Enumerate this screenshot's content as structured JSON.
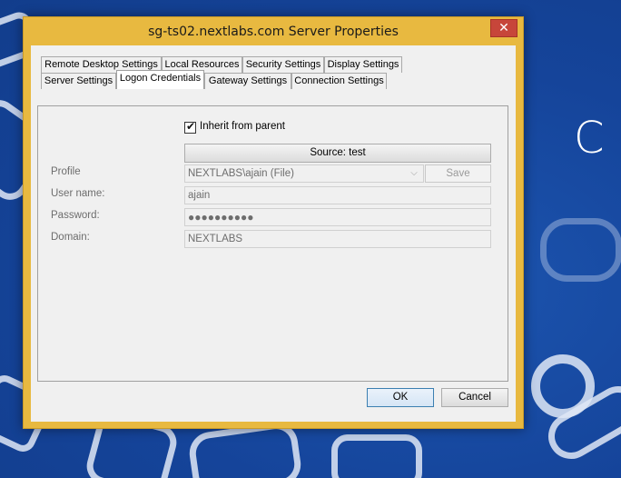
{
  "desktop": {
    "wallpaper_letter": "C"
  },
  "window": {
    "title": "sg-ts02.nextlabs.com Server Properties",
    "close_glyph": "✕"
  },
  "tabs_row1": [
    {
      "label": "Remote Desktop Settings"
    },
    {
      "label": "Local Resources"
    },
    {
      "label": "Security Settings"
    },
    {
      "label": "Display Settings"
    }
  ],
  "tabs_row2": [
    {
      "label": "Server Settings"
    },
    {
      "label": "Logon Credentials",
      "active": true
    },
    {
      "label": "Gateway Settings"
    },
    {
      "label": "Connection Settings"
    }
  ],
  "credentials": {
    "inherit_label": "Inherit from parent",
    "inherit_checked": true,
    "source_button": "Source: test",
    "profile_label": "Profile",
    "profile_value": "NEXTLABS\\ajain (File)",
    "save_button": "Save",
    "username_label": "User name:",
    "username_value": "ajain",
    "password_label": "Password:",
    "password_value": "●●●●●●●●●●",
    "domain_label": "Domain:",
    "domain_value": "NEXTLABS"
  },
  "buttons": {
    "ok": "OK",
    "cancel": "Cancel"
  },
  "colors": {
    "titlebar": "#e8b940",
    "close": "#c7463a",
    "desktop": "#16479a"
  }
}
